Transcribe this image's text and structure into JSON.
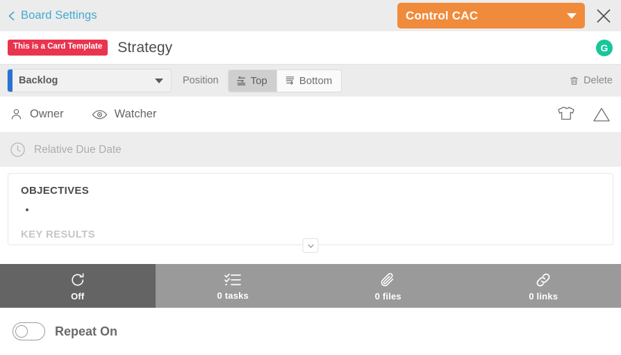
{
  "topbar": {
    "back_label": "Board Settings",
    "board_name": "Control CAC",
    "close_icon": "close-icon",
    "back_icon": "chevron-left-icon",
    "caret_icon": "chevron-down-icon",
    "accent_color": "#f08b3c",
    "link_color": "#43a8d4"
  },
  "title_row": {
    "template_badge": "This is a Card Template",
    "badge_color": "#e8344e",
    "card_title": "Strategy",
    "avatar_initial": "G",
    "avatar_color": "#17c79a"
  },
  "status_row": {
    "status_value": "Backlog",
    "status_accent_color": "#2a72d4",
    "position_label": "Position",
    "position_options": [
      {
        "label": "Top",
        "icon": "move-to-top-icon",
        "selected": true
      },
      {
        "label": "Bottom",
        "icon": "move-to-bottom-icon",
        "selected": false
      }
    ],
    "delete_label": "Delete",
    "delete_icon": "trash-icon"
  },
  "people_row": {
    "owner_label": "Owner",
    "owner_icon": "person-icon",
    "watcher_label": "Watcher",
    "watcher_icon": "eye-icon",
    "size_icon": "tshirt-icon",
    "priority_icon": "triangle-icon"
  },
  "due_row": {
    "label": "Relative Due Date",
    "icon": "clock-icon"
  },
  "description": {
    "heading_objectives": "OBJECTIVES",
    "bullets": [
      ""
    ],
    "heading_key_results": "KEY RESULTS",
    "expand_icon": "chevron-down-icon"
  },
  "tabs": [
    {
      "label": "Off",
      "icon": "repeat-icon",
      "active": true
    },
    {
      "label": "0 tasks",
      "icon": "checklist-icon",
      "active": false
    },
    {
      "label": "0 files",
      "icon": "paperclip-icon",
      "active": false
    },
    {
      "label": "0 links",
      "icon": "link-icon",
      "active": false
    }
  ],
  "repeat_row": {
    "toggle_state": "off",
    "label": "Repeat On"
  }
}
